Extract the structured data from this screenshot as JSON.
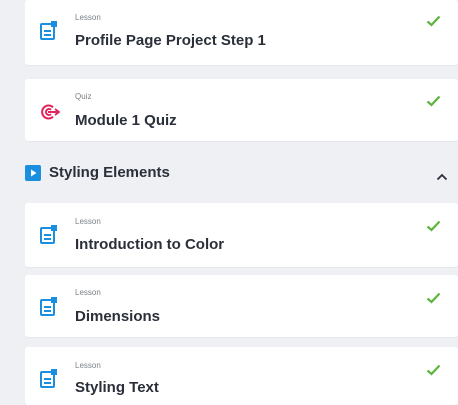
{
  "items_top": [
    {
      "type": "Lesson",
      "title": "Profile Page Project Step 1",
      "icon": "lesson-doc-icon",
      "completed": true
    },
    {
      "type": "Quiz",
      "title": "Module 1 Quiz",
      "icon": "quiz-target-icon",
      "completed": true
    }
  ],
  "section": {
    "title": "Styling Elements",
    "icon": "play-icon",
    "expanded": true
  },
  "items_section": [
    {
      "type": "Lesson",
      "title": "Introduction to Color",
      "icon": "lesson-doc-icon",
      "completed": true
    },
    {
      "type": "Lesson",
      "title": "Dimensions",
      "icon": "lesson-doc-icon",
      "completed": true
    },
    {
      "type": "Lesson",
      "title": "Styling Text",
      "icon": "lesson-doc-icon",
      "completed": true
    }
  ],
  "colors": {
    "lesson_icon": "#1a8fe0",
    "quiz_icon": "#e0245e",
    "check": "#5cb33d",
    "section_icon": "#1a8fe0",
    "background": "#eef0f4"
  }
}
